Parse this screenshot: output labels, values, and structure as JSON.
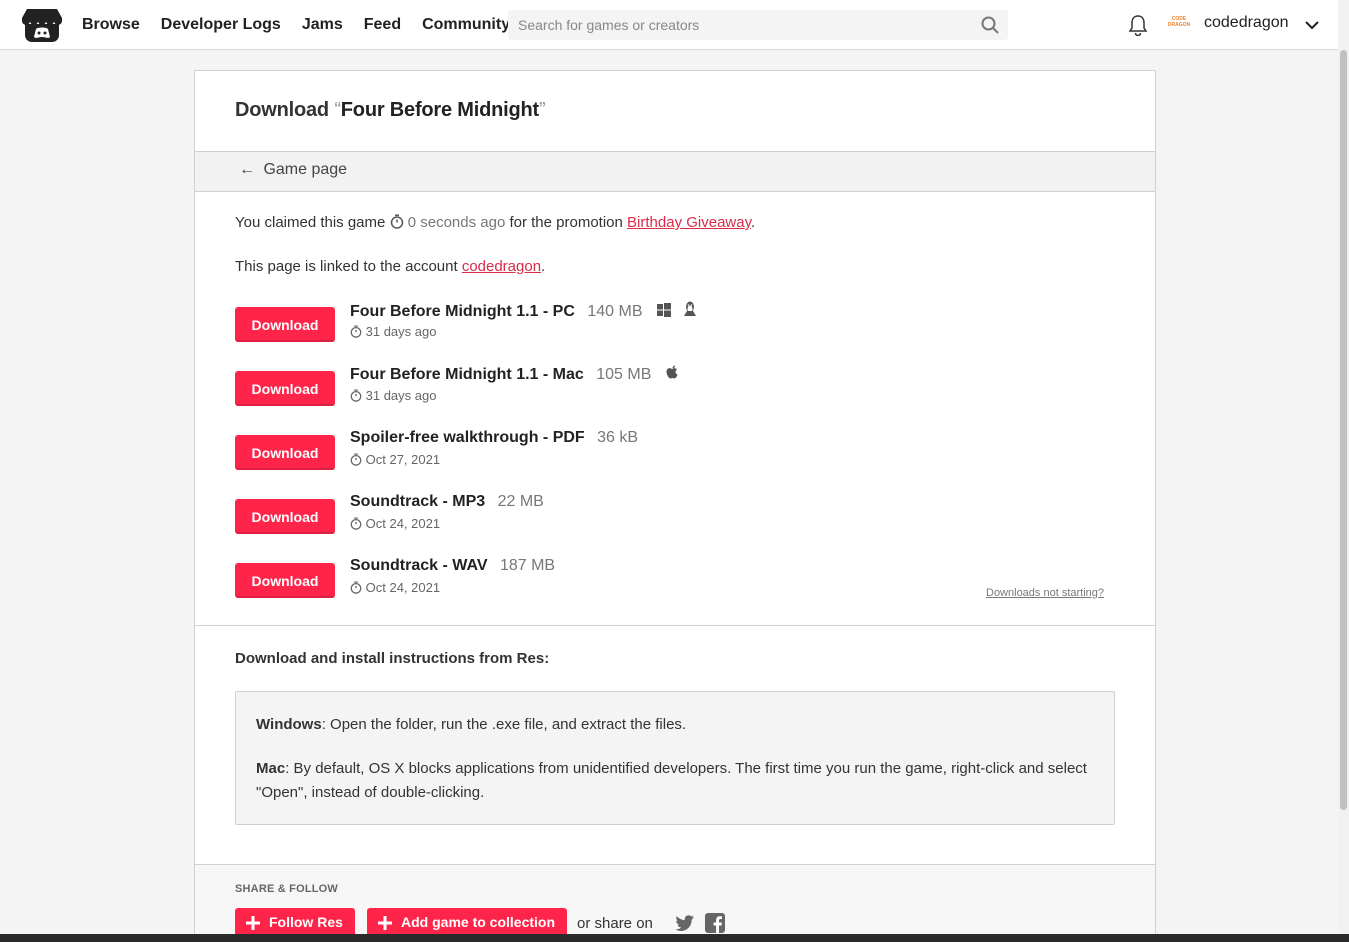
{
  "header": {
    "nav": [
      "Browse",
      "Developer Logs",
      "Jams",
      "Feed",
      "Community"
    ],
    "search_placeholder": "Search for games or creators",
    "avatar_text": "CODE DRAGON",
    "username": "codedragon"
  },
  "page": {
    "title_prefix": "Download",
    "open_quote": "“",
    "game_title": "Four Before Midnight",
    "close_quote": "”",
    "back_label": "Game page",
    "claim": {
      "before": "You claimed this game",
      "time": "0 seconds ago",
      "middle": "for the promotion",
      "promotion": "Birthday Giveaway",
      "after": "."
    },
    "linked": {
      "before": "This page is linked to the account",
      "account": "codedragon",
      "after": "."
    },
    "download_label": "Download",
    "downloads": [
      {
        "name": "Four Before Midnight 1.1 - PC",
        "size": "140 MB",
        "date": "31 days ago",
        "platforms": [
          "windows",
          "linux"
        ]
      },
      {
        "name": "Four Before Midnight 1.1 - Mac",
        "size": "105 MB",
        "date": "31 days ago",
        "platforms": [
          "apple"
        ]
      },
      {
        "name": "Spoiler-free walkthrough - PDF",
        "size": "36 kB",
        "date": "Oct 27, 2021",
        "platforms": []
      },
      {
        "name": "Soundtrack - MP3",
        "size": "22 MB",
        "date": "Oct 24, 2021",
        "platforms": []
      },
      {
        "name": "Soundtrack - WAV",
        "size": "187 MB",
        "date": "Oct 24, 2021",
        "platforms": []
      }
    ],
    "downloads_help": "Downloads not starting?",
    "instructions_heading": "Download and install instructions from Res:",
    "instructions": {
      "windows_label": "Windows",
      "windows_text": ": Open the folder, run the .exe file, and extract the files.",
      "mac_label": "Mac",
      "mac_text": ": By default, OS X blocks applications from unidentified developers. The first time you run the game, right-click and select \"Open\", instead of double-clicking."
    },
    "share": {
      "heading": "SHARE & FOLLOW",
      "follow_label": "Follow Res",
      "collection_label": "Add game to collection",
      "share_on": "or share on"
    }
  },
  "colors": {
    "accent": "#ff2449",
    "link": "#da2c49"
  }
}
